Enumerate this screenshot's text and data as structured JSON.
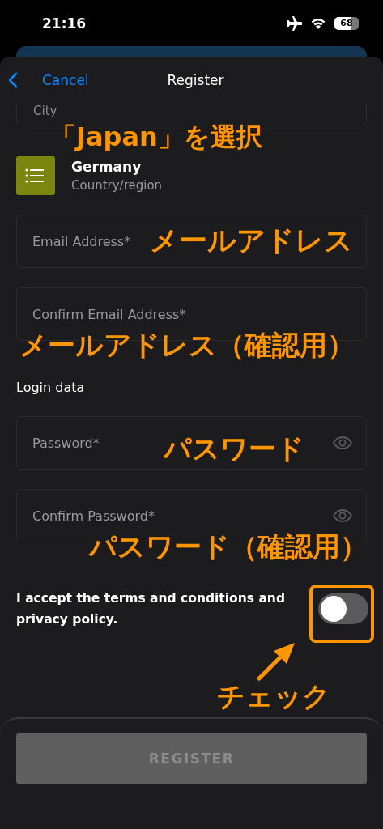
{
  "status_bar": {
    "time": "21:16",
    "battery": "68"
  },
  "nav": {
    "back": "Cancel",
    "title": "Register"
  },
  "city_field": {
    "label": "City"
  },
  "country": {
    "value": "Germany",
    "label": "Country/region"
  },
  "fields": [
    {
      "placeholder": "Email Address*"
    },
    {
      "placeholder": "Confirm Email Address*"
    }
  ],
  "login_section": {
    "heading": "Login data"
  },
  "password_fields": [
    {
      "placeholder": "Password*"
    },
    {
      "placeholder": "Confirm Password*"
    }
  ],
  "terms": {
    "text": "I accept the terms and conditions and privacy policy.",
    "on": false
  },
  "register_button": {
    "label": "REGISTER",
    "disabled": true
  },
  "annotations": [
    {
      "text": "「Japan」を選択"
    },
    {
      "text": "メールアドレス"
    },
    {
      "text": "メールアドレス（確認用）"
    },
    {
      "text": "パスワード"
    },
    {
      "text": "パスワード（確認用）"
    },
    {
      "text": "チェック"
    }
  ]
}
